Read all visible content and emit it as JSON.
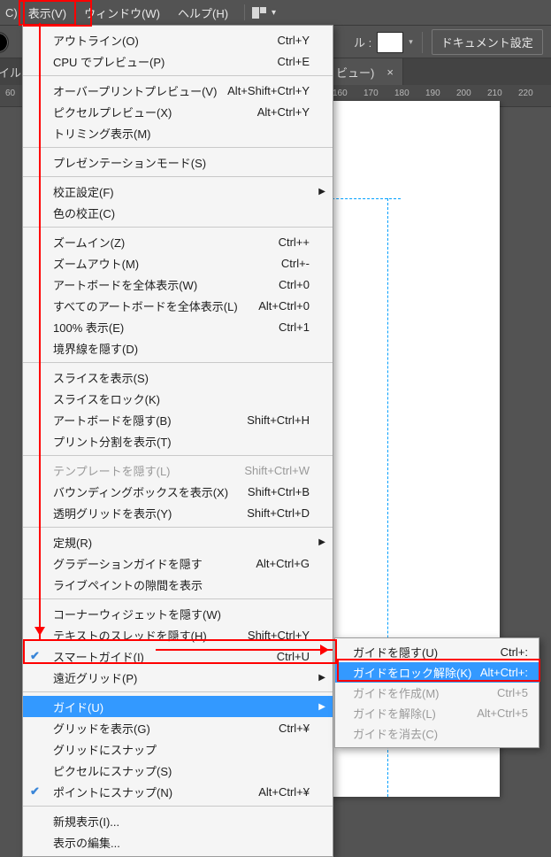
{
  "menubar": {
    "leftFragment": "C)",
    "view": "表示(V)",
    "window": "ウィンドウ(W)",
    "help": "ヘルプ(H)"
  },
  "ctrl": {
    "rulerLabel": "ル :",
    "docSettings": "ドキュメント設定"
  },
  "tabbar": {
    "fileFragment": "イル…",
    "viewFragment": "ビュー)",
    "close": "×"
  },
  "ruler": {
    "left": "60",
    "ticks": [
      "160",
      "170",
      "180",
      "190",
      "200",
      "210",
      "220"
    ]
  },
  "menu": [
    {
      "label": "アウトライン(O)",
      "key": "Ctrl+Y"
    },
    {
      "label": "CPU でプレビュー(P)",
      "key": "Ctrl+E"
    },
    {
      "sep": true
    },
    {
      "label": "オーバープリントプレビュー(V)",
      "key": "Alt+Shift+Ctrl+Y"
    },
    {
      "label": "ピクセルプレビュー(X)",
      "key": "Alt+Ctrl+Y"
    },
    {
      "label": "トリミング表示(M)"
    },
    {
      "sep": true
    },
    {
      "label": "プレゼンテーションモード(S)"
    },
    {
      "sep": true
    },
    {
      "label": "校正設定(F)",
      "sub": true
    },
    {
      "label": "色の校正(C)"
    },
    {
      "sep": true
    },
    {
      "label": "ズームイン(Z)",
      "key": "Ctrl++"
    },
    {
      "label": "ズームアウト(M)",
      "key": "Ctrl+-"
    },
    {
      "label": "アートボードを全体表示(W)",
      "key": "Ctrl+0"
    },
    {
      "label": "すべてのアートボードを全体表示(L)",
      "key": "Alt+Ctrl+0"
    },
    {
      "label": "100% 表示(E)",
      "key": "Ctrl+1"
    },
    {
      "label": "境界線を隠す(D)"
    },
    {
      "sep": true
    },
    {
      "label": "スライスを表示(S)"
    },
    {
      "label": "スライスをロック(K)"
    },
    {
      "label": "アートボードを隠す(B)",
      "key": "Shift+Ctrl+H"
    },
    {
      "label": "プリント分割を表示(T)"
    },
    {
      "sep": true
    },
    {
      "label": "テンプレートを隠す(L)",
      "key": "Shift+Ctrl+W",
      "dis": true
    },
    {
      "label": "バウンディングボックスを表示(X)",
      "key": "Shift+Ctrl+B"
    },
    {
      "label": "透明グリッドを表示(Y)",
      "key": "Shift+Ctrl+D"
    },
    {
      "sep": true
    },
    {
      "label": "定規(R)",
      "sub": true
    },
    {
      "label": "グラデーションガイドを隠す",
      "key": "Alt+Ctrl+G"
    },
    {
      "label": "ライブペイントの隙間を表示"
    },
    {
      "sep": true
    },
    {
      "label": "コーナーウィジェットを隠す(W)"
    },
    {
      "label": "テキストのスレッドを隠す(H)",
      "key": "Shift+Ctrl+Y"
    },
    {
      "label": "スマートガイド(I)",
      "key": "Ctrl+U",
      "chk": true
    },
    {
      "label": "遠近グリッド(P)",
      "sub": true
    },
    {
      "sep": true
    },
    {
      "label": "ガイド(U)",
      "sub": true,
      "hl": true
    },
    {
      "label": "グリッドを表示(G)",
      "key": "Ctrl+¥"
    },
    {
      "label": "グリッドにスナップ"
    },
    {
      "label": "ピクセルにスナップ(S)"
    },
    {
      "label": "ポイントにスナップ(N)",
      "key": "Alt+Ctrl+¥",
      "chk": true
    },
    {
      "sep": true
    },
    {
      "label": "新規表示(I)..."
    },
    {
      "label": "表示の編集..."
    }
  ],
  "submenu": [
    {
      "label": "ガイドを隠す(U)",
      "key": "Ctrl+:"
    },
    {
      "label": "ガイドをロック解除(K)",
      "key": "Alt+Ctrl+:",
      "hl": true
    },
    {
      "label": "ガイドを作成(M)",
      "key": "Ctrl+5",
      "dis": true
    },
    {
      "label": "ガイドを解除(L)",
      "key": "Alt+Ctrl+5",
      "dis": true
    },
    {
      "label": "ガイドを消去(C)",
      "dis": true
    }
  ]
}
